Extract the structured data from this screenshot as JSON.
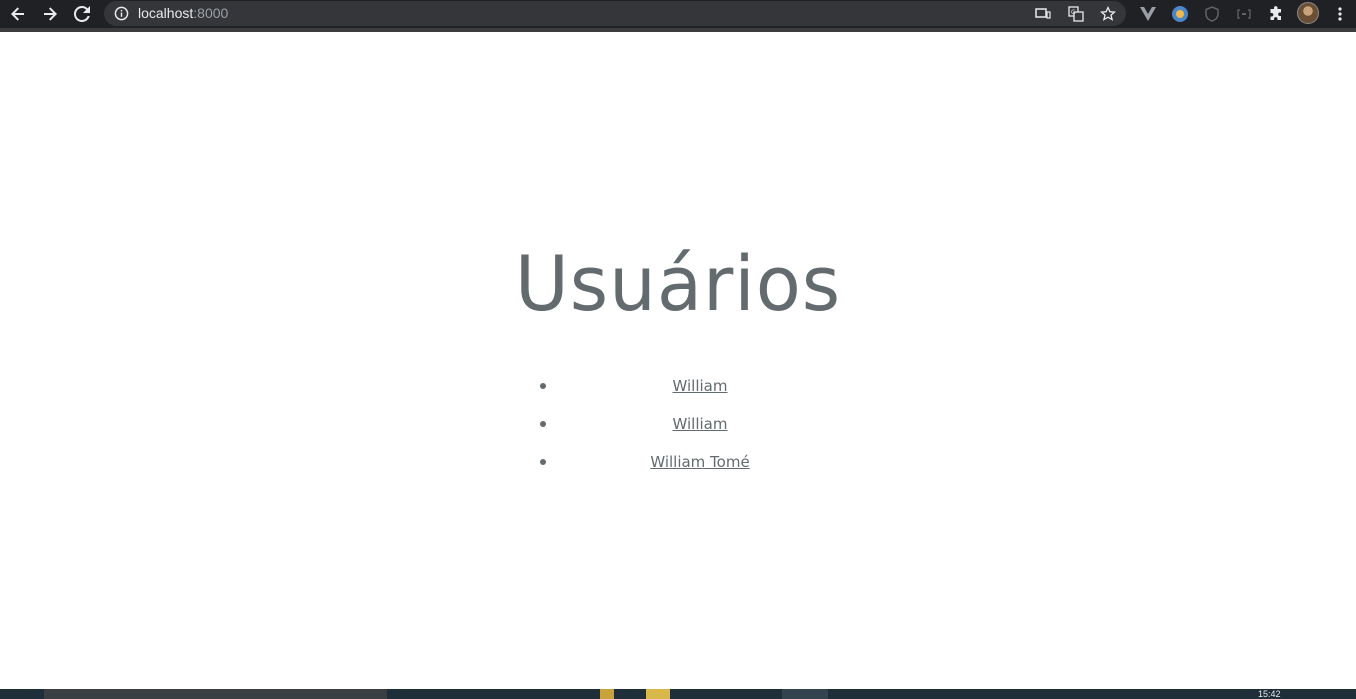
{
  "browser": {
    "url_host": "localhost",
    "url_port": ":8000",
    "icons": {
      "back": "back-arrow-icon",
      "forward": "forward-arrow-icon",
      "reload": "reload-icon",
      "site_info": "info-icon",
      "cast": "cast-icon",
      "translate": "translate-icon",
      "bookmark": "star-icon",
      "extensions": [
        "vue-devtools-icon",
        "extension-badge-icon",
        "shield-icon",
        "bracket-extension-icon",
        "puzzle-icon"
      ],
      "menu": "kebab-menu-icon"
    }
  },
  "page": {
    "title": "Usuários",
    "users": [
      {
        "name": "William"
      },
      {
        "name": "William"
      },
      {
        "name": "William Tomé"
      }
    ]
  },
  "taskbar": {
    "clock": "15:42"
  },
  "colors": {
    "chrome_bg": "#202124",
    "omnibox_bg": "#35363a",
    "text_primary": "#636b6f",
    "taskbar_bg": "#1f2f3a"
  }
}
